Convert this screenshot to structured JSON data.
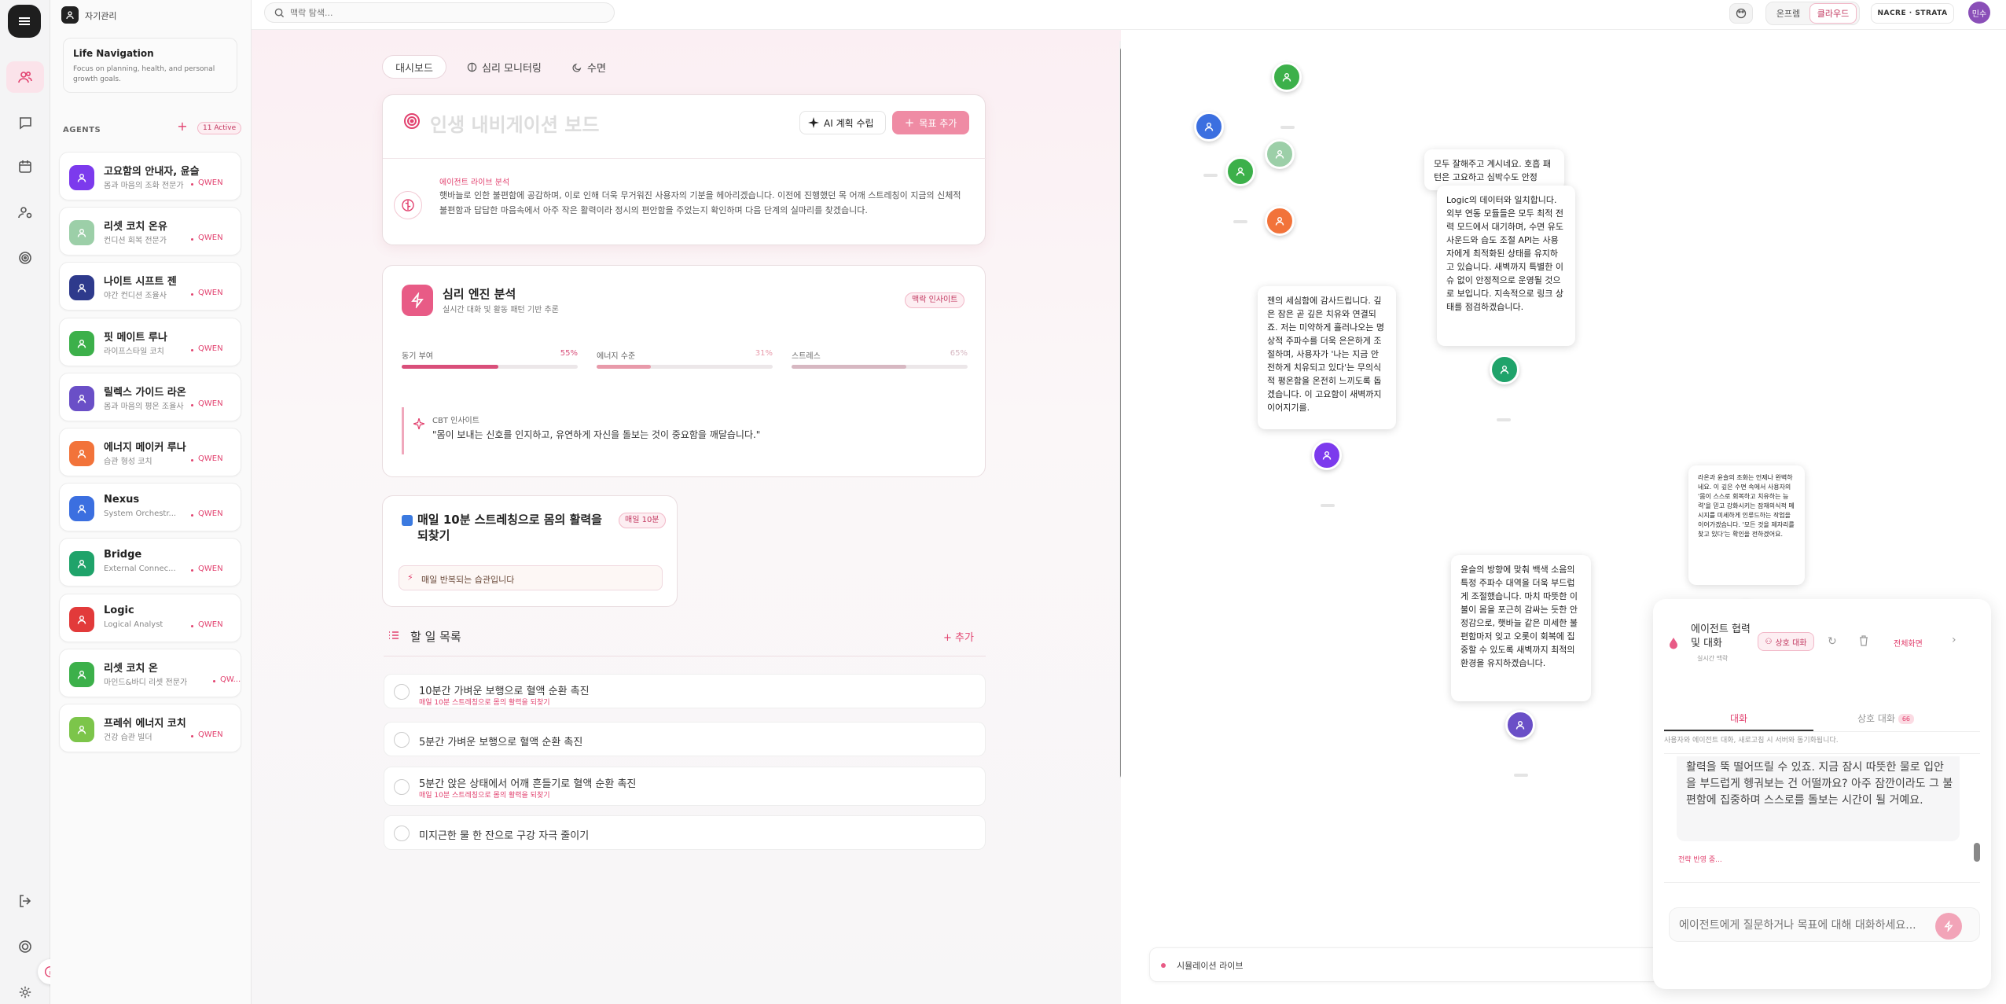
{
  "app": {
    "section_title": "자기관리",
    "user_initials": "민수"
  },
  "search": {
    "placeholder": "맥락 탐색..."
  },
  "topbar": {
    "mode_online": "온프렘",
    "mode_cloud": "클라우드",
    "stack_label": "NACRE · STRATA"
  },
  "sidebar": {
    "nav_title": "Life Navigation",
    "nav_desc": "Focus on planning, health, and personal growth goals.",
    "agents_label": "AGENTS",
    "active_badge": "11 Active",
    "agents": [
      {
        "name": "고요함의 안내자, 윤슬",
        "role": "몸과 마음의 조화 전문가",
        "model": "QWEN",
        "color": "#7c3aed"
      },
      {
        "name": "리셋 코치 온유",
        "role": "컨디션 회복 전문가",
        "model": "QWEN",
        "color": "#9ccfa8"
      },
      {
        "name": "나이트 시프트 젠",
        "role": "야간 컨디션 조율사",
        "model": "QWEN",
        "color": "#2e3a8c"
      },
      {
        "name": "핏 메이트 루나",
        "role": "라이프스타일 코치",
        "model": "QWEN",
        "color": "#3cb04a"
      },
      {
        "name": "릴렉스 가이드 라온",
        "role": "몸과 마음의 평온 조율사",
        "model": "QWEN",
        "color": "#6a4fc7"
      },
      {
        "name": "에너지 메이커 루나",
        "role": "습관 형성 코치",
        "model": "QWEN",
        "color": "#f2733a"
      },
      {
        "name": "Nexus",
        "role": "System Orchestr...",
        "model": "QWEN",
        "color": "#3b6fe0"
      },
      {
        "name": "Bridge",
        "role": "External Connec...",
        "model": "QWEN",
        "color": "#1fa36a"
      },
      {
        "name": "Logic",
        "role": "Logical Analyst",
        "model": "QWEN",
        "color": "#e23a3a"
      },
      {
        "name": "리셋 코치 온",
        "role": "마인드&바디 리셋 전문가",
        "model": "QW...",
        "color": "#3cb04a"
      },
      {
        "name": "프레쉬 에너지 코치",
        "role": "건강 습관 빌더",
        "model": "QWEN",
        "color": "#7cc54a"
      }
    ]
  },
  "main": {
    "tabs": [
      "대시보드",
      "심리 모니터링",
      "수면"
    ],
    "board_title": "인생 내비게이션 보드",
    "ai_plan_button": "AI 계획 수립",
    "add_goal_button": "목표 추가",
    "live_label": "에이전트 라이브 분석",
    "live_text": "햇바늘로 인한 불편함에 공감하며, 이로 인해 더욱 무거워진 사용자의 기분을 헤아리겠습니다. 이전에 진행했던 목 어깨 스트레칭이 지금의 신체적 불편함과 답답한 마음속에서 아주 작은 활력이라 정시의 편안함을 주었는지 확인하며 다음 단계의 실마리를 찾겠습니다.",
    "psych": {
      "title": "심리 엔진 분석",
      "subtitle": "실시간 대화 및 활동 패턴 기반 추론",
      "badge": "맥락 인사이트",
      "metrics": [
        {
          "label": "동기 부여",
          "value_text": "55%",
          "value": 55,
          "color": "#d94f7a"
        },
        {
          "label": "에너지 수준",
          "value_text": "31%",
          "value": 31,
          "color": "#e89aaa"
        },
        {
          "label": "스트레스",
          "value_text": "65%",
          "value": 65,
          "color": "#d7b8c2"
        }
      ],
      "cbt_label": "CBT 인사이트",
      "cbt_text": "\"몸이 보내는 신호를 인지하고, 유연하게 자신을 돌보는 것이 중요함을 깨달습니다.\""
    },
    "habit": {
      "title": "매일 10분 스트레칭으로 몸의 활력을 되찾기",
      "badge": "매일 10분",
      "note": "매일 반복되는 습관입니다"
    },
    "todo": {
      "title": "할 일 목록",
      "add_label": "+ 추가",
      "items": [
        {
          "text": "10분간 가벼운 보행으로 혈액 순환 촉진",
          "sub": "매일 10분 스트레칭으로 몸의 활력을 되찾기"
        },
        {
          "text": "5분간 가벼운 보행으로 혈액 순환 촉진",
          "sub": ""
        },
        {
          "text": "5분간 앉은 상태에서 어깨 흔들기로 혈액 순환 촉진",
          "sub": "매일 10분 스트레칭으로 몸의 활력을 되찾기"
        },
        {
          "text": "미지근한 물 한 잔으로 구강 자극 줄이기",
          "sub": ""
        }
      ]
    }
  },
  "graph": {
    "bubbles": [
      "모두 잘해주고 계시네요. 호흡 패턴은 고요하고 심박수도 안정",
      "Logic의 데이터와 일치합니다. 외부 연동 모듈들은 모두 최적 전력 모드에서 대기하며, 수면 유도 사운드와 습도 조절 API는 사용자에게 최적화된 상태를 유지하고 있습니다. 새벽까지 특별한 이슈 없이 안정적으로 운영될 것으로 보입니다. 지속적으로 링크 상태를 점검하겠습니다.",
      "젠의 세심함에 감사드립니다. 깊은 잠은 곧 깊은 치유와 연결되죠. 저는 미약하게 흘러나오는 명상적 주파수를 더욱 은은하게 조절하며, 사용자가 '나는 지금 안전하게 치유되고 있다'는 무의식적 평온함을 온전히 느끼도록 돕겠습니다. 이 고요함이 새벽까지 이어지기를.",
      "라온과 윤슬의 조화는 언제나 완벽하네요. 이 깊은 수면 속에서 사용자의 '몸이 스스로 회복하고 치유하는 능력'을 믿고 강화시키는 잠재의식적 메시지를 미세하게 인류드하는 작업을 이어가겠습니다. '모든 것을 제자리를 찾고 있다'는 확인을 전하겠어요.",
      "윤슬의 방향에 맞춰 백색 소음의 특정 주파수 대역을 더욱 부드럽게 조절했습니다. 마치 따뜻한 이불이 몸을 포근히 감싸는 듯한 안정감으로, 햇바늘 같은 미세한 불편함마저 잊고 오롯이 회복에 집중할 수 있도록 새벽까지 최적의 환경을 유지하겠습니다."
    ],
    "live_label": "시뮬레이션 라이브"
  },
  "chat": {
    "title": "에이전트 협력 및 대화",
    "subtitle": "실시간 맥락",
    "mutual_button": "상호 대화",
    "fullscreen_button": "전체화면",
    "tab_chat": "대화",
    "tab_mutual": "상호 대화",
    "tab_mutual_badge": "66",
    "info": "사용자와 에이전트 대화, 새로고침 시 서버와 동기화됩니다.",
    "message": "활력을 뚝 떨어뜨릴 수 있죠. 지금 잠시 따뜻한 물로 입안을 부드럽게 헹궈보는 건 어떨까요? 아주 잠깐이라도 그 불편함에 집중하며 스스로를 돌보는 시간이 될 거예요.",
    "status": "전략 반영 중...",
    "input_placeholder": "에이전트에게 질문하거나 목표에 대해 대화하세요..."
  }
}
